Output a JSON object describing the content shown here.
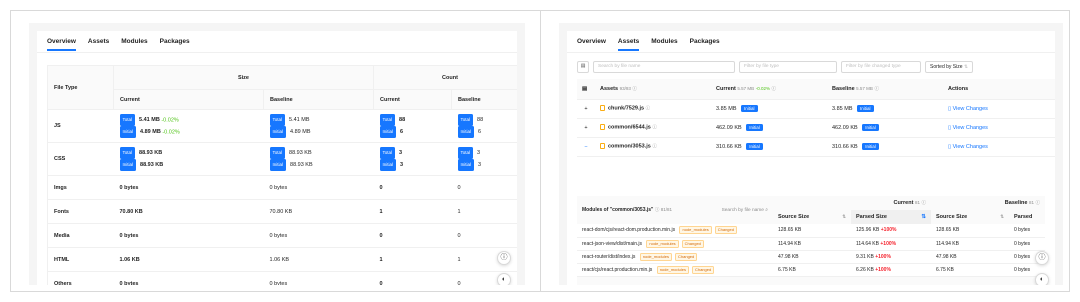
{
  "left": {
    "tabs": [
      "Overview",
      "Assets",
      "Modules",
      "Packages"
    ],
    "header": {
      "file_type": "File Type",
      "size": "Size",
      "count": "Count",
      "current": "Current",
      "baseline": "Baseline"
    },
    "tag_total": "Total",
    "tag_initial": "Initial",
    "rows": [
      {
        "label": "JS",
        "cur_total": "5.41 MB",
        "cur_total_diff": "-0.02%",
        "cur_initial": "4.89 MB",
        "cur_initial_diff": "-0.02%",
        "base_total": "5.41 MB",
        "base_initial": "4.89 MB",
        "cnt_total": "88",
        "cnt_initial": "6",
        "bcnt_total": "88",
        "bcnt_initial": "6"
      },
      {
        "label": "CSS",
        "cur_total": "88.93 KB",
        "cur_initial": "88.93 KB",
        "base_total": "88.93 KB",
        "base_initial": "88.93 KB",
        "cnt_total": "3",
        "cnt_initial": "3",
        "bcnt_total": "3",
        "bcnt_initial": "3"
      }
    ],
    "simple_rows": [
      {
        "label": "Imgs",
        "cur": "0 bytes",
        "base": "0 bytes",
        "cnt": "0",
        "bcnt": "0"
      },
      {
        "label": "Fonts",
        "cur": "70.80 KB",
        "base": "70.80 KB",
        "cnt": "1",
        "bcnt": "1"
      },
      {
        "label": "Media",
        "cur": "0 bytes",
        "base": "0 bytes",
        "cnt": "0",
        "bcnt": "0"
      },
      {
        "label": "HTML",
        "cur": "1.06 KB",
        "base": "1.06 KB",
        "cnt": "1",
        "bcnt": "1"
      },
      {
        "label": "Others",
        "cur": "0 bytes",
        "base": "0 bytes",
        "cnt": "0",
        "bcnt": "0"
      }
    ]
  },
  "right": {
    "tabs": [
      "Overview",
      "Assets",
      "Modules",
      "Packages"
    ],
    "filters": {
      "name": "Search by file name",
      "type": "Filter by file type",
      "changed": "Filter by file changed type",
      "sort": "Sorted by Size"
    },
    "header": {
      "assets": "Assets",
      "assets_count": "93/93",
      "current": "Current",
      "current_size": "5.57 MB",
      "current_diff": "-0.02%",
      "baseline": "Baseline",
      "baseline_size": "5.57 MB",
      "actions": "Actions"
    },
    "tag_initial": "Initial",
    "view_changes": "View Changes",
    "assets": [
      {
        "name": "chunk/7529.js",
        "current": "3.85 MB",
        "baseline": "3.85 MB",
        "expander": "+"
      },
      {
        "name": "common/6544.js",
        "current": "462.09 KB",
        "baseline": "462.09 KB",
        "expander": "+"
      },
      {
        "name": "common/3053.js",
        "current": "310.66 KB",
        "baseline": "310.66 KB",
        "expander": "−"
      }
    ],
    "modules": {
      "title": "Modules of \"common/3053.js\"",
      "count": "81/81",
      "search": "Search by file name",
      "current": "Current",
      "current_count": "81",
      "baseline": "Baseline",
      "baseline_count": "81",
      "source_size": "Source Size",
      "parsed_size": "Parsed Size",
      "parsed_short": "Parsed",
      "tag_node": "node_modules",
      "tag_changed": "Changed",
      "rows": [
        {
          "path": "react-dom/cjs/react-dom.production.min.js",
          "source": "128.65 KB",
          "parsed": "125.96 KB",
          "diff": "+100%",
          "bsource": "128.65 KB",
          "bparsed": "0 bytes"
        },
        {
          "path": "react-json-view/dist/main.js",
          "source": "114.94 KB",
          "parsed": "114.64 KB",
          "diff": "+100%",
          "bsource": "114.94 KB",
          "bparsed": "0 bytes"
        },
        {
          "path": "react-router/dist/index.js",
          "source": "47.98 KB",
          "parsed": "9.31 KB",
          "diff": "+100%",
          "bsource": "47.98 KB",
          "bparsed": "0 bytes"
        },
        {
          "path": "react/cjs/react.production.min.js",
          "source": "6.75 KB",
          "parsed": "6.26 KB",
          "diff": "+100%",
          "bsource": "6.75 KB",
          "bparsed": "0 bytes"
        }
      ]
    }
  }
}
